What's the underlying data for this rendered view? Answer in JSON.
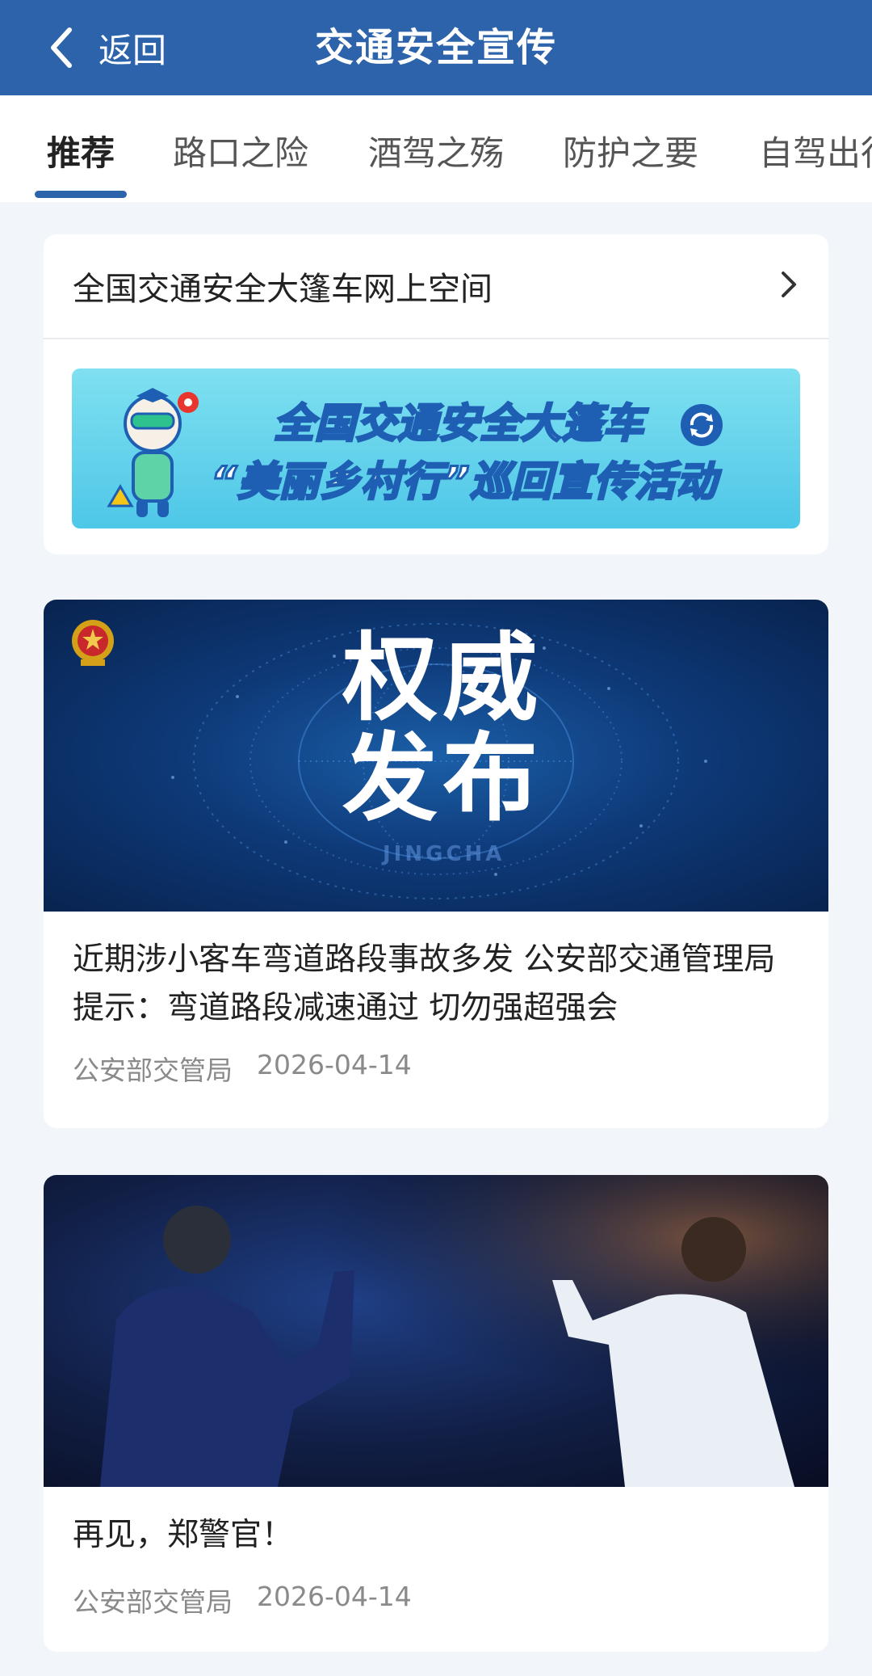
{
  "header": {
    "back_label": "返回",
    "title": "交通安全宣传",
    "color": "#2d63ab"
  },
  "tabs": [
    {
      "label": "推荐",
      "active": true
    },
    {
      "label": "路口之险"
    },
    {
      "label": "酒驾之殇"
    },
    {
      "label": "防护之要"
    },
    {
      "label": "自驾出行"
    }
  ],
  "promo": {
    "title": "全国交通安全大篷车网上空间",
    "banner": {
      "line1": "全国交通安全大篷车",
      "line2": "“美丽乡村行”巡回宣传活动"
    }
  },
  "news": [
    {
      "image_text": [
        "权威",
        "发布"
      ],
      "image_watermark": "JINGCHA",
      "title": "近期涉小客车弯道路段事故多发 公安部交通管理局提示：弯道路段减速通过 切勿强超强会",
      "source": "公安部交管局",
      "date": "2026-04-14"
    },
    {
      "title": "再见，郑警官！",
      "source": "公安部交管局",
      "date": "2026-04-14"
    }
  ]
}
